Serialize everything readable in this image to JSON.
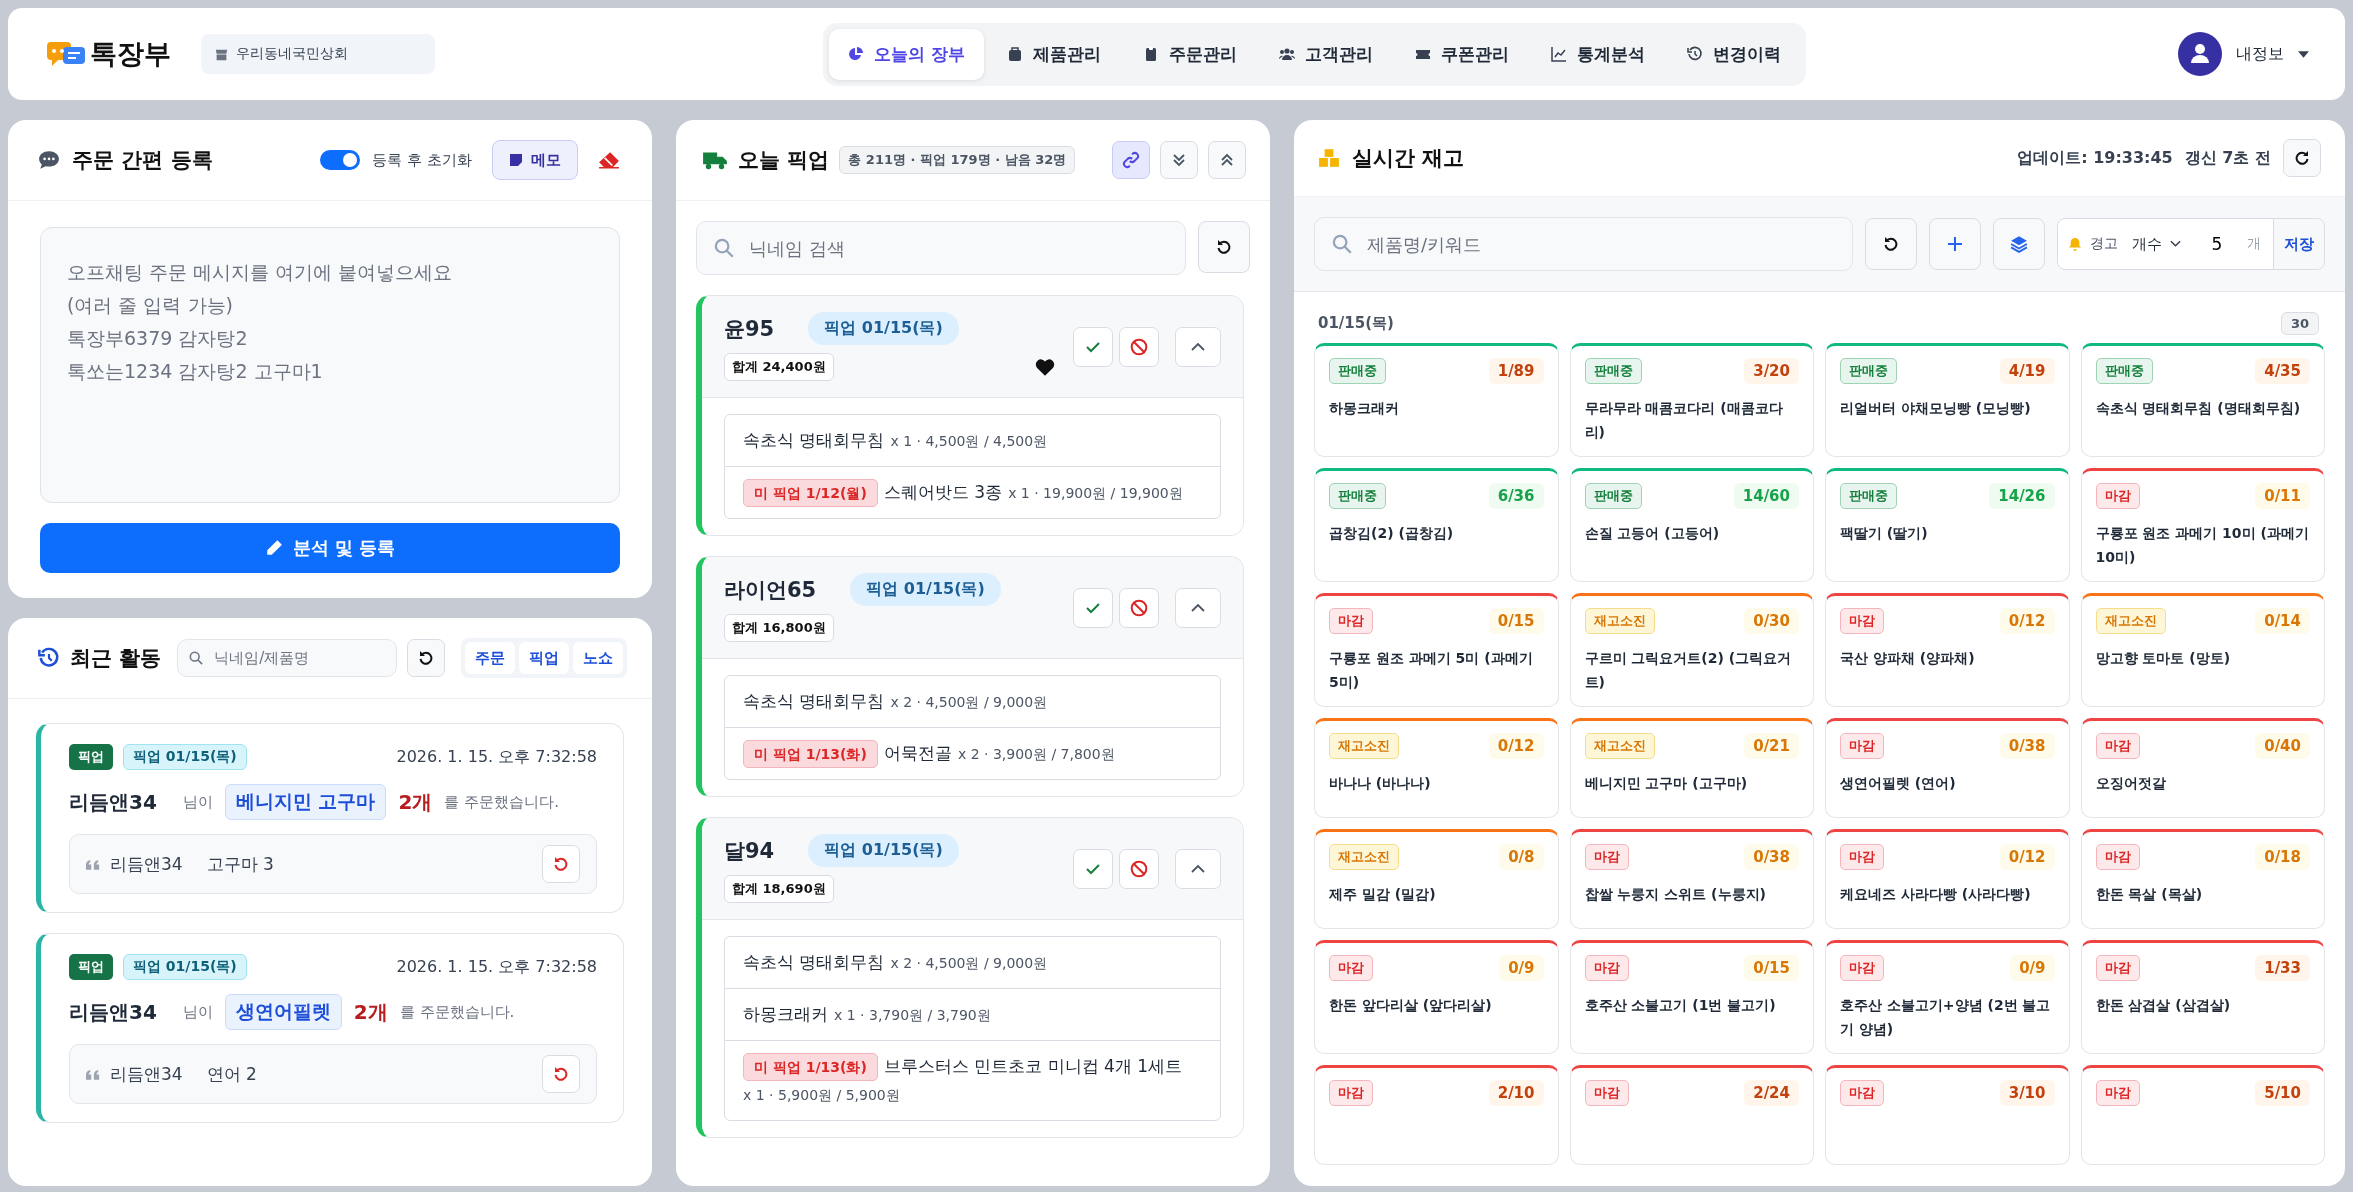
{
  "header": {
    "logo_text": "톡장부",
    "store": "우리동네국민상회",
    "tabs": [
      {
        "kind": "pie",
        "label": "오늘의 장부",
        "selected": true
      },
      {
        "kind": "box",
        "label": "제품관리",
        "selected": false
      },
      {
        "kind": "clipboard",
        "label": "주문관리",
        "selected": false
      },
      {
        "kind": "users",
        "label": "고객관리",
        "selected": false
      },
      {
        "kind": "ticket",
        "label": "쿠폰관리",
        "selected": false
      },
      {
        "kind": "chart",
        "label": "통계분석",
        "selected": false
      },
      {
        "kind": "history",
        "label": "변경이력",
        "selected": false
      }
    ],
    "user": "내정보"
  },
  "order_entry": {
    "title": "주문 간편 등록",
    "reset_toggle": {
      "label": "등록 후 초기화",
      "on": true
    },
    "memo_button": "메모",
    "placeholder": "오프채팅 주문 메시지를 여기에 붙여넣으세요\n(여러 줄 입력 가능)\n톡장부6379 감자탕2\n톡쏘는1234 감자탕2 고구마1",
    "submit": "분석 및 등록"
  },
  "activity": {
    "title": "최근 활동",
    "search_placeholder": "닉네임/제품명",
    "filters": [
      "주문",
      "픽업",
      "노쇼"
    ],
    "items": [
      {
        "kind": "pickup",
        "tag": "픽업",
        "date": "픽업 01/15(목)",
        "time": "2026. 1. 15. 오후 7:32:58",
        "name": "리듬앤34",
        "suffix": "님이",
        "product": "베니지민 고구마",
        "qty": "2개",
        "verb": "를 주문했습니다.",
        "quote_name": "리듬앤34",
        "quote_text": "고구마 3"
      },
      {
        "kind": "pickup",
        "tag": "픽업",
        "date": "픽업 01/15(목)",
        "time": "2026. 1. 15. 오후 7:32:58",
        "name": "리듬앤34",
        "suffix": "님이",
        "product": "생연어필렛",
        "qty": "2개",
        "verb": "를 주문했습니다.",
        "quote_name": "리듬앤34",
        "quote_text": "연어 2"
      }
    ]
  },
  "pickup": {
    "title": "오늘 픽업",
    "summary": "총 211명 · 픽업 179명 · 남음 32명",
    "tools": [
      {
        "kind": "link",
        "selected": true
      },
      {
        "kind": "expand",
        "selected": false
      },
      {
        "kind": "collapse",
        "selected": false
      }
    ],
    "search_placeholder": "닉네임 검색",
    "cards": [
      {
        "name": "윤95",
        "date": "픽업 01/15(목)",
        "total": "합계 24,400원",
        "favorite": true,
        "expanded": true,
        "items": [
          {
            "name": "속초식 명태회무침",
            "detail": "x 1 · 4,500원 / 4,500원"
          },
          {
            "unpicked": "미 픽업 1/12(월)",
            "name": "스퀘어밧드 3종",
            "detail": "x 1 · 19,900원 / 19,900원"
          }
        ]
      },
      {
        "name": "라이언65",
        "date": "픽업 01/15(목)",
        "total": "합계 16,800원",
        "favorite": false,
        "expanded": true,
        "items": [
          {
            "name": "속초식 명태회무침",
            "detail": "x 2 · 4,500원 / 9,000원"
          },
          {
            "unpicked": "미 픽업 1/13(화)",
            "name": "어묵전골",
            "detail": "x 2 · 3,900원 / 7,800원"
          }
        ]
      },
      {
        "name": "달94",
        "date": "픽업 01/15(목)",
        "total": "합계 18,690원",
        "favorite": false,
        "expanded": true,
        "items": [
          {
            "name": "속초식 명태회무침",
            "detail": "x 2 · 4,500원 / 9,000원"
          },
          {
            "name": "하몽크래커",
            "detail": "x 1 · 3,790원 / 3,790원"
          },
          {
            "unpicked": "미 픽업 1/13(화)",
            "name": "브루스터스 민트초코 미니컵 4개 1세트",
            "detail": "x 1 · 5,900원 / 5,900원"
          }
        ]
      }
    ]
  },
  "stock": {
    "title": "실시간 재고",
    "updated": "업데이트: 19:33:45",
    "refreshed": "갱신 7초 전",
    "search_placeholder": "제품명/키워드",
    "alert": {
      "label": "경고",
      "mode": "개수",
      "value": "5",
      "unit": "개",
      "save": "저장"
    },
    "group": {
      "date": "01/15(목)",
      "count": "30"
    },
    "items": [
      {
        "status": {
          "kind": "selling",
          "label": "판매중"
        },
        "count": {
          "kind": "low",
          "text": "1/89"
        },
        "name": "하몽크래커"
      },
      {
        "status": {
          "kind": "selling",
          "label": "판매중"
        },
        "count": {
          "kind": "low",
          "text": "3/20"
        },
        "name": "무라무라 매콤코다리 (매콤코다리)"
      },
      {
        "status": {
          "kind": "selling",
          "label": "판매중"
        },
        "count": {
          "kind": "low",
          "text": "4/19"
        },
        "name": "리얼버터 야채모닝빵 (모닝빵)"
      },
      {
        "status": {
          "kind": "selling",
          "label": "판매중"
        },
        "count": {
          "kind": "low",
          "text": "4/35"
        },
        "name": "속초식 명태회무침 (명태회무침)"
      },
      {
        "status": {
          "kind": "selling",
          "label": "판매중"
        },
        "count": {
          "kind": "ok",
          "text": "6/36"
        },
        "name": "곱창김(2) (곱창김)"
      },
      {
        "status": {
          "kind": "selling",
          "label": "판매중"
        },
        "count": {
          "kind": "ok",
          "text": "14/60"
        },
        "name": "손질 고등어 (고등어)"
      },
      {
        "status": {
          "kind": "selling",
          "label": "판매중"
        },
        "count": {
          "kind": "ok",
          "text": "14/26"
        },
        "name": "팩딸기 (딸기)"
      },
      {
        "status": {
          "kind": "closed",
          "label": "마감"
        },
        "count": {
          "kind": "empty",
          "text": "0/11"
        },
        "name": "구룡포 원조 과메기 10미 (과메기 10미)"
      },
      {
        "status": {
          "kind": "closed",
          "label": "마감"
        },
        "count": {
          "kind": "empty",
          "text": "0/15"
        },
        "name": "구룡포 원조 과메기 5미 (과메기 5미)"
      },
      {
        "status": {
          "kind": "soldout",
          "label": "재고소진"
        },
        "count": {
          "kind": "empty",
          "text": "0/30"
        },
        "name": "구르미 그릭요거트(2) (그릭요거트)"
      },
      {
        "status": {
          "kind": "closed",
          "label": "마감"
        },
        "count": {
          "kind": "empty",
          "text": "0/12"
        },
        "name": "국산 양파채 (양파채)"
      },
      {
        "status": {
          "kind": "soldout",
          "label": "재고소진"
        },
        "count": {
          "kind": "empty",
          "text": "0/14"
        },
        "name": "망고향 토마토 (망토)"
      },
      {
        "status": {
          "kind": "soldout",
          "label": "재고소진"
        },
        "count": {
          "kind": "empty",
          "text": "0/12"
        },
        "name": "바나나 (바나나)"
      },
      {
        "status": {
          "kind": "soldout",
          "label": "재고소진"
        },
        "count": {
          "kind": "empty",
          "text": "0/21"
        },
        "name": "베니지민 고구마 (고구마)"
      },
      {
        "status": {
          "kind": "closed",
          "label": "마감"
        },
        "count": {
          "kind": "empty",
          "text": "0/38"
        },
        "name": "생연어필렛 (연어)"
      },
      {
        "status": {
          "kind": "closed",
          "label": "마감"
        },
        "count": {
          "kind": "empty",
          "text": "0/40"
        },
        "name": "오징어젓갈"
      },
      {
        "status": {
          "kind": "soldout",
          "label": "재고소진"
        },
        "count": {
          "kind": "empty",
          "text": "0/8"
        },
        "name": "제주 밀감 (밀감)"
      },
      {
        "status": {
          "kind": "closed",
          "label": "마감"
        },
        "count": {
          "kind": "empty",
          "text": "0/38"
        },
        "name": "찹쌀 누룽지 스위트 (누룽지)"
      },
      {
        "status": {
          "kind": "closed",
          "label": "마감"
        },
        "count": {
          "kind": "empty",
          "text": "0/12"
        },
        "name": "케요네즈 사라다빵 (사라다빵)"
      },
      {
        "status": {
          "kind": "closed",
          "label": "마감"
        },
        "count": {
          "kind": "empty",
          "text": "0/18"
        },
        "name": "한돈 목살 (목살)"
      },
      {
        "status": {
          "kind": "closed",
          "label": "마감"
        },
        "count": {
          "kind": "empty",
          "text": "0/9"
        },
        "name": "한돈 앞다리살 (앞다리살)"
      },
      {
        "status": {
          "kind": "closed",
          "label": "마감"
        },
        "count": {
          "kind": "empty",
          "text": "0/15"
        },
        "name": "호주산 소불고기 (1번 불고기)"
      },
      {
        "status": {
          "kind": "closed",
          "label": "마감"
        },
        "count": {
          "kind": "empty",
          "text": "0/9"
        },
        "name": "호주산 소불고기+양념 (2번 불고기 양념)"
      },
      {
        "status": {
          "kind": "closed",
          "label": "마감"
        },
        "count": {
          "kind": "low",
          "text": "1/33"
        },
        "name": "한돈 삼겹살 (삼겹살)"
      },
      {
        "status": {
          "kind": "closed",
          "label": "마감"
        },
        "count": {
          "kind": "low",
          "text": "2/10"
        }
      },
      {
        "status": {
          "kind": "closed",
          "label": "마감"
        },
        "count": {
          "kind": "low",
          "text": "2/24"
        }
      },
      {
        "status": {
          "kind": "closed",
          "label": "마감"
        },
        "count": {
          "kind": "low",
          "text": "3/10"
        }
      },
      {
        "status": {
          "kind": "closed",
          "label": "마감"
        },
        "count": {
          "kind": "low",
          "text": "5/10"
        }
      }
    ]
  }
}
